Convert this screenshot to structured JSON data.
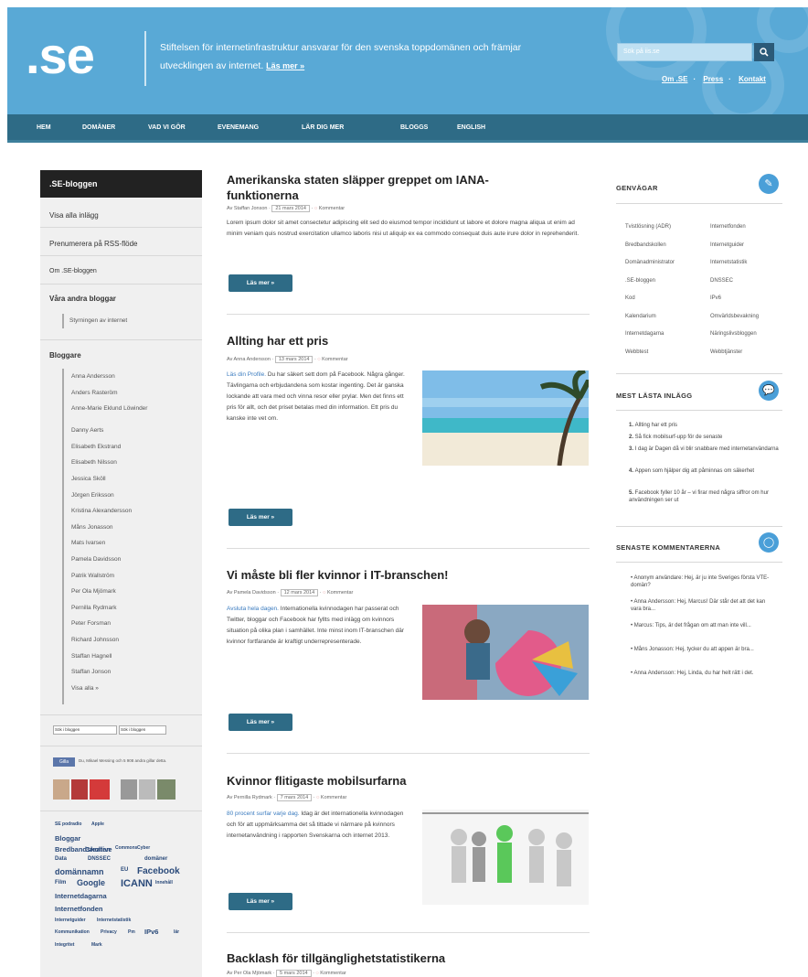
{
  "header": {
    "logo": ".se",
    "tagline": "Stiftelsen för internetinfrastruktur ansvarar för den svenska toppdomänen och främjar utvecklingen av internet.",
    "read_more": "Läs mer »",
    "search_placeholder": "Sök på iis.se",
    "links": [
      "Om .SE",
      "Press",
      "Kontakt"
    ],
    "brand_color": "#59a9d6"
  },
  "nav": {
    "items": [
      "Hem",
      "Domäner",
      "Vad vi gör",
      "Evenemang",
      "Lär dig mer",
      "Bloggs",
      "English"
    ]
  },
  "sidebar": {
    "title": ".SE-bloggen",
    "links": [
      "Visa alla inlägg",
      "Prenumerera på RSS-flöde",
      "Om .SE-bloggen"
    ],
    "other_blogs_heading": "Våra andra bloggar",
    "other_blogs": [
      "Styrningen av internet"
    ],
    "bloggers_heading": "Bloggare",
    "bloggers": [
      "Anna Andersson",
      "Anders Rasteröm",
      "Anne-Marie Eklund Löwinder",
      "Danny Aerts",
      "Elisabeth Ekstrand",
      "Elisabeth Nilsson",
      "Jessica Sköll",
      "Jörgen Eriksson",
      "Kristina Alexandersson",
      "Måns Jonasson",
      "Mats Ivarsen",
      "Pamela Davidsson",
      "Patrik Wallström",
      "Per Ola Mjömark",
      "Pernilla Rydmark",
      "Peter Forsman",
      "Richard Johnsson",
      "Staffan Hagnell",
      "Staffan Jonson",
      "Visa alla »"
    ],
    "search_label": "Sök i bloggen",
    "search_button": "Sök i bloggen",
    "fb_like": "Gilla",
    "fb_text": "Du, Mikael Messing och 5 908 andra gillar detta.",
    "tags": [
      "SE podradio",
      "Apple",
      "Bloggar",
      "Bredbandskollen",
      "Creative",
      "Commons",
      "Cyber",
      "Data",
      "DNSSEC",
      "domäner",
      "domännamn",
      "EU",
      "Facebook",
      "Film",
      "Google",
      "ICANN",
      "Innehåll",
      "Internetdagarna",
      "Internetfonden",
      "Internetguider",
      "Internetstatistik",
      "Kommunikation",
      "Privacy",
      "Pm",
      "IPv6",
      "lär",
      "Integritet",
      "Mark"
    ]
  },
  "articles": [
    {
      "title": "Amerikanska staten släpper greppet om IANA-funktionerna",
      "author": "Av Staffan Jonson",
      "date": "21 mars 2014",
      "comments": "Kommentar",
      "text": "Lorem ipsum dolor sit amet consectetur adipiscing elit sed do eiusmod tempor incididunt ut labore et dolore magna aliqua ut enim ad minim veniam quis nostrud exercitation ullamco laboris nisi ut aliquip ex ea commodo consequat duis aute irure dolor in reprehenderit.",
      "read_more": "Läs mer »"
    },
    {
      "title": "Allting har ett pris",
      "author": "Av Anna Andersson",
      "date": "13 mars 2014",
      "comments": "Kommentar",
      "lead": "Läs din Profile.",
      "text": "Du har säkert sett dom på Facebook. Några gånger. Tävlingarna och erbjudandena som kostar ingenting. Det är ganska lockande att vara med och vinna resor eller prylar. Men det finns ett pris för allt, och det priset betalas med din information. Ett pris du kanske inte vet om.",
      "read_more": "Läs mer »"
    },
    {
      "title": "Vi måste bli fler kvinnor i IT-branschen!",
      "author": "Av Pamela Davidsson",
      "date": "12 mars 2014",
      "comments": "Kommentar",
      "lead": "Avsluta hela dagen.",
      "text": "Internationella kvinnodagen har passerat och Twitter, bloggar och Facebook har fyllts med inlägg om kvinnors situation på olika plan i samhället. Inte minst inom IT-branschen där kvinnor fortfarande är kraftigt underrepresenterade.",
      "read_more": "Läs mer »"
    },
    {
      "title": "Kvinnor flitigaste mobilsurfarna",
      "author": "Av Pernilla Rydmark",
      "date": "7 mars 2014",
      "comments": "Kommentar",
      "lead": "80 procent surfar varje dag.",
      "text": "Idag är det internationella kvinnodagen och för att uppmärksamma det så tittade vi närmare på kvinnors internetanvändning i rapporten Svenskarna och internet 2013.",
      "read_more": "Läs mer »"
    },
    {
      "title": "Backlash för tillgänglighetstatistikerna",
      "author": "Av Per Ola Mjömark",
      "date": "5 mars 2014",
      "comments": "Kommentar"
    }
  ],
  "right": {
    "shortcuts_title": "Genvägar",
    "shortcuts": [
      [
        "Tvistlösning (ADR)",
        "Internetfonden"
      ],
      [
        "Bredbandskollen",
        "Internetguider"
      ],
      [
        "Domänadministrator",
        "Internetstatistik"
      ],
      [
        ".SE-bloggen",
        "DNSSEC"
      ],
      [
        "Kod",
        "IPv6"
      ],
      [
        "Kalendarium",
        "Omvärldsbevakning"
      ],
      [
        "Internetdagarna",
        "Näringslivsbloggen"
      ],
      [
        "Webbtest",
        "Webbtjänster"
      ]
    ],
    "most_read_title": "Mest lästa inlägg",
    "most_read": [
      "Allting har ett pris",
      "Så fick mobilsurf-upp för de senaste",
      "I dag är Dagen då vi blir snabbare med internetanvändarna",
      "Appen som hjälper dig att påminnas om säkerhet",
      "Facebook fyller 10 år – vi firar med några siffror om hur användningen ser ut"
    ],
    "comments_title": "Senaste kommentarerna",
    "comments": [
      "Anonym användare: Hej, är ju inte Sveriges första VTE-domän?",
      "Anna Andersson: Hej, Marcus! Där står det att det kan vara bra...",
      "Marcus: Tips, är det frågan om att man inte vill...",
      "Måns Jonasson: Hej, tycker du att appen är bra...",
      "Anna Andersson: Hej, Linda, du har helt rätt i det."
    ]
  }
}
